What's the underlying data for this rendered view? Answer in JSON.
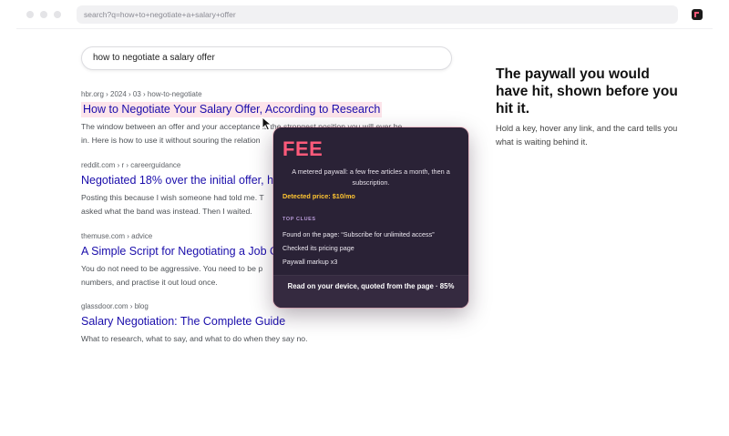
{
  "browser": {
    "url": "search?q=how+to+negotiate+a+salary+offer"
  },
  "search": {
    "query": "how to negotiate a salary offer"
  },
  "results": [
    {
      "crumb": "hbr.org › 2024 › 03 › how-to-negotiate",
      "title": "How to Negotiate Your Salary Offer, According to Research",
      "snippet_1": "The window between an offer and your acceptance is the strongest position you will ever be",
      "snippet_2": "in. Here is how to use it without souring the relation"
    },
    {
      "crumb": "reddit.com › r › careerguidance",
      "title": "Negotiated 18% over the initial offer, he",
      "snippet_1": "Posting this because I wish someone had told me. T",
      "snippet_2": "asked what the band was instead. Then I waited."
    },
    {
      "crumb": "themuse.com › advice",
      "title": "A Simple Script for Negotiating a Job O",
      "snippet_1": "You do not need to be aggressive. You need to be p",
      "snippet_2": "numbers, and practise it out loud once."
    },
    {
      "crumb": "glassdoor.com › blog",
      "title": "Salary Negotiation: The Complete Guide",
      "snippet_1": "What to research, what to say, and what to do when they say no.",
      "snippet_2": ""
    }
  ],
  "promo": {
    "title": "The paywall you would have hit, shown before you hit it.",
    "text": "Hold a key, hover any link, and the card tells you what is waiting behind it."
  },
  "card": {
    "logo": "FEE",
    "description": "A metered paywall: a few free articles a month, then a subscription.",
    "price": "Detected price: $10/mo",
    "clues_heading": "TOP CLUES",
    "clues": [
      "Found on the page: “Subscribe for unlimited access”",
      "Checked its pricing page",
      "Paywall markup x3"
    ],
    "footer": "Read on your device, quoted from the page · 85%"
  },
  "colors": {
    "accent": "#ff5a7a",
    "price": "#ffc531",
    "link": "#1a0dab",
    "card_bg": "#2a2236"
  }
}
